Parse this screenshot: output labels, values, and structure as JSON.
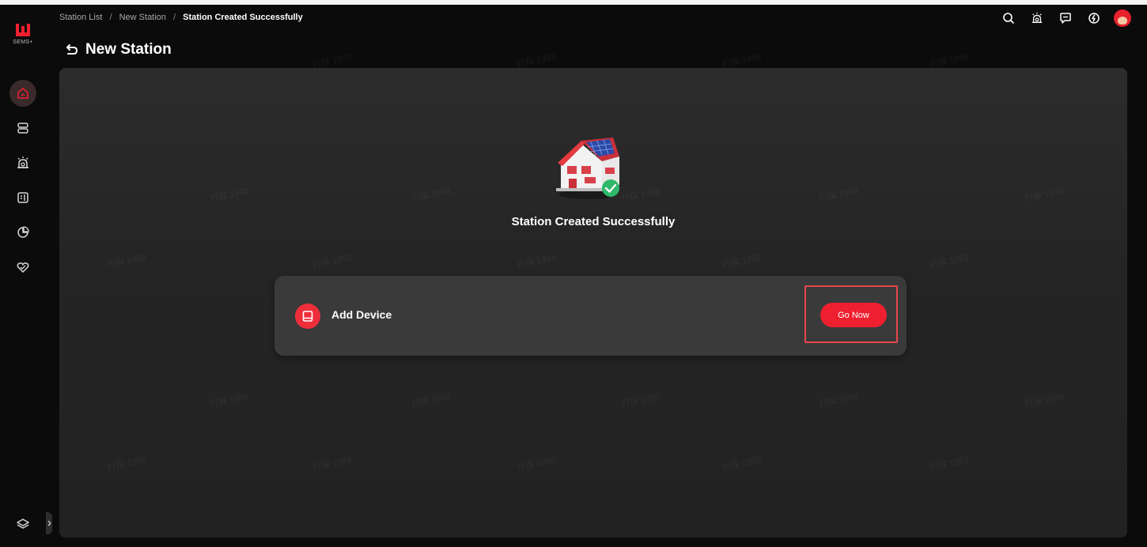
{
  "app": {
    "logo_sub": "SEMS+",
    "accent_color": "#ee2030"
  },
  "breadcrumb": {
    "items": [
      "Station List",
      "New Station"
    ],
    "current": "Station Created Successfully",
    "separator": "/"
  },
  "page": {
    "title": "New Station"
  },
  "sidebar": {
    "items": [
      {
        "icon": "home-icon",
        "active": true
      },
      {
        "icon": "device-list-icon",
        "active": false
      },
      {
        "icon": "alarm-icon",
        "active": false
      },
      {
        "icon": "report-icon",
        "active": false
      },
      {
        "icon": "analysis-pie-icon",
        "active": false
      },
      {
        "icon": "service-heart-icon",
        "active": false
      }
    ],
    "bottom_icon": "layers-icon"
  },
  "header_icons": [
    "search-icon",
    "alarm-icon",
    "message-icon",
    "energy-icon",
    "user-avatar"
  ],
  "main": {
    "success_title": "Station Created Successfully",
    "card": {
      "label": "Add Device",
      "button_label": "Go Now",
      "icon": "device-icon"
    },
    "watermark_text": "行探 1993"
  }
}
